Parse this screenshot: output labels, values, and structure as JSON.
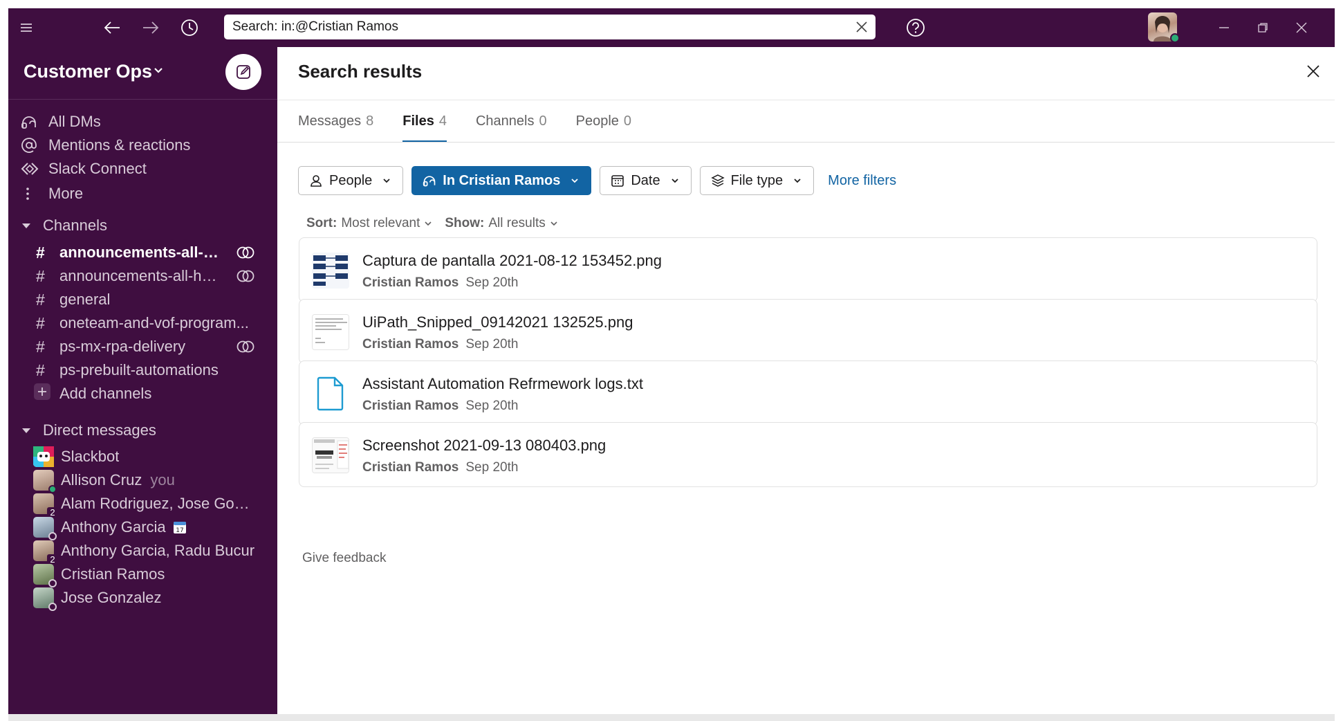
{
  "colors": {
    "aubergine": "#3f0e40",
    "accent_blue": "#1264a3",
    "presence_green": "#2bac76"
  },
  "topbar": {
    "icons": [
      "menu-icon",
      "back-arrow-icon",
      "forward-arrow-icon",
      "history-icon",
      "help-icon",
      "minimize-icon",
      "restore-icon",
      "close-window-icon"
    ],
    "search_value": "Search: in:@Cristian Ramos"
  },
  "sidebar": {
    "workspace_name": "Customer Ops",
    "nav": [
      {
        "label": "All DMs",
        "icon": "dms-icon"
      },
      {
        "label": "Mentions & reactions",
        "icon": "at-icon"
      },
      {
        "label": "Slack Connect",
        "icon": "connect-icon"
      },
      {
        "label": "More",
        "icon": "more-vertical-icon"
      }
    ],
    "channels_heading": "Channels",
    "channels": [
      {
        "label": "announcements-all-h...",
        "bold": true,
        "shared": true
      },
      {
        "label": "announcements-all-ha...",
        "bold": false,
        "shared": true
      },
      {
        "label": "general",
        "bold": false,
        "shared": false
      },
      {
        "label": "oneteam-and-vof-program...",
        "bold": false,
        "shared": false
      },
      {
        "label": "ps-mx-rpa-delivery",
        "bold": false,
        "shared": true
      },
      {
        "label": "ps-prebuilt-automations",
        "bold": false,
        "shared": false
      }
    ],
    "add_channels": "Add channels",
    "dm_heading": "Direct messages",
    "dms": [
      {
        "label": "Slackbot",
        "suffix": ""
      },
      {
        "label": "Allison Cruz",
        "suffix": "you"
      },
      {
        "label": "Alam Rodriguez, Jose Gonz...",
        "suffix": "",
        "count": "2"
      },
      {
        "label": "Anthony Garcia",
        "suffix": "",
        "status_icon": "calendar-icon"
      },
      {
        "label": "Anthony Garcia, Radu Bucur",
        "suffix": "",
        "count": "2"
      },
      {
        "label": "Cristian Ramos",
        "suffix": ""
      },
      {
        "label": "Jose Gonzalez",
        "suffix": ""
      }
    ]
  },
  "main": {
    "title": "Search results",
    "tabs": [
      {
        "label": "Messages",
        "count": "8",
        "active": false
      },
      {
        "label": "Files",
        "count": "4",
        "active": true
      },
      {
        "label": "Channels",
        "count": "0",
        "active": false
      },
      {
        "label": "People",
        "count": "0",
        "active": false
      }
    ],
    "filters": [
      {
        "label": "People",
        "icon": "person-icon",
        "active": false
      },
      {
        "label": "In Cristian Ramos",
        "icon": "dms-icon",
        "active": true
      },
      {
        "label": "Date",
        "icon": "calendar-icon",
        "active": false
      },
      {
        "label": "File type",
        "icon": "layers-icon",
        "active": false
      }
    ],
    "more_filters": "More filters",
    "sort_label": "Sort:",
    "sort_value": "Most relevant",
    "show_label": "Show:",
    "show_value": "All results",
    "files": [
      {
        "name": "Captura de pantalla 2021-08-12 153452.png",
        "author": "Cristian Ramos",
        "date": "Sep 20th",
        "thumb": "diagram"
      },
      {
        "name": "UiPath_Snipped_09142021 132525.png",
        "author": "Cristian Ramos",
        "date": "Sep 20th",
        "thumb": "text"
      },
      {
        "name": "Assistant Automation Refrmework logs.txt",
        "author": "Cristian Ramos",
        "date": "Sep 20th",
        "thumb": "file-icon"
      },
      {
        "name": "Screenshot 2021-09-13 080403.png",
        "author": "Cristian Ramos",
        "date": "Sep 20th",
        "thumb": "screenshot"
      }
    ],
    "feedback": "Give feedback"
  }
}
